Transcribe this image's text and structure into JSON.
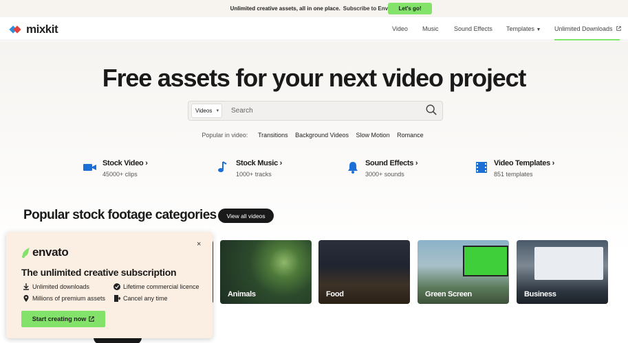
{
  "promo": {
    "text": "Unlimited creative assets, all in one place.",
    "sub": "Subscribe to Envato.",
    "button": "Let's go!"
  },
  "nav": {
    "logo": "mixkit",
    "items": [
      "Video",
      "Music",
      "Sound Effects",
      "Templates",
      "Unlimited Downloads"
    ]
  },
  "hero": {
    "headline": "Free assets for your next video project",
    "search": {
      "select": "Videos",
      "placeholder": "Search"
    },
    "popular": {
      "label": "Popular in video:",
      "tags": [
        "Transitions",
        "Background Videos",
        "Slow Motion",
        "Romance"
      ]
    }
  },
  "categories": [
    {
      "title": "Stock Video",
      "sub": "45000+ clips",
      "icon": "video-camera-icon"
    },
    {
      "title": "Stock Music",
      "sub": "1000+ tracks",
      "icon": "music-note-icon"
    },
    {
      "title": "Sound Effects",
      "sub": "3000+ sounds",
      "icon": "bell-icon"
    },
    {
      "title": "Video Templates",
      "sub": "851 templates",
      "icon": "film-strip-icon"
    }
  ],
  "section": {
    "title": "Popular stock footage categories",
    "view_all": "View all videos",
    "tiles": [
      "Animals",
      "Food",
      "Green Screen",
      "Business"
    ]
  },
  "modal": {
    "brand": "envato",
    "title": "The unlimited creative subscription",
    "features": [
      "Unlimited downloads",
      "Lifetime commercial licence",
      "Millions of premium assets",
      "Cancel any time"
    ],
    "cta": "Start creating now",
    "close": "×"
  },
  "colors": {
    "accent": "#82e26a",
    "dark": "#191919",
    "modal_bg": "#fbeee2"
  }
}
